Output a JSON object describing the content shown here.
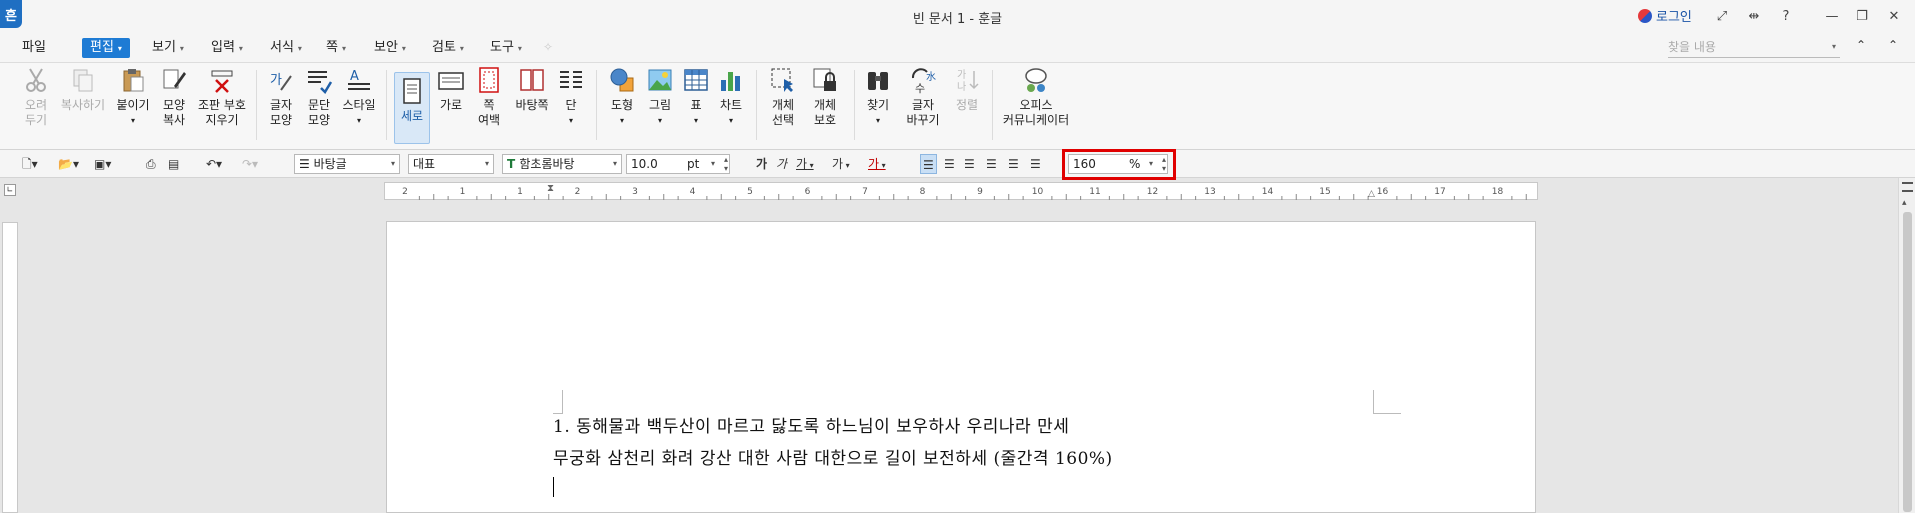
{
  "app": {
    "logo_letter": "흔",
    "title": "빈 문서 1 - 훈글",
    "login_label": "로그인"
  },
  "window_buttons": [
    "⤢",
    "⇹",
    "?",
    "—",
    "❐",
    "✕"
  ],
  "menus": [
    {
      "label": "파일",
      "arrow": ""
    },
    {
      "label": "편집",
      "arrow": "▾"
    },
    {
      "label": "보기",
      "arrow": "▾"
    },
    {
      "label": "입력",
      "arrow": "▾"
    },
    {
      "label": "서식",
      "arrow": "▾"
    },
    {
      "label": "쪽",
      "arrow": "▾"
    },
    {
      "label": "보안",
      "arrow": "▾"
    },
    {
      "label": "검토",
      "arrow": "▾"
    },
    {
      "label": "도구",
      "arrow": "▾"
    }
  ],
  "search": {
    "placeholder": "찾을 내용"
  },
  "ribbon": {
    "cut": [
      "오려",
      "두기"
    ],
    "copy": [
      "복사하기"
    ],
    "paste": [
      "붙이기"
    ],
    "format_copy": [
      "모양",
      "복사"
    ],
    "erase_marks": [
      "조판 부호",
      "지우기"
    ],
    "char_shape": [
      "글자",
      "모양"
    ],
    "para_shape": [
      "문단",
      "모양"
    ],
    "style": [
      "스타일"
    ],
    "portrait": [
      "세로"
    ],
    "landscape": [
      "가로"
    ],
    "page_margin": [
      "쪽",
      "여백"
    ],
    "background": [
      "바탕쪽"
    ],
    "columns": [
      "단"
    ],
    "shape": [
      "도형"
    ],
    "picture": [
      "그림"
    ],
    "table": [
      "표"
    ],
    "chart": [
      "차트"
    ],
    "select_object": [
      "개체",
      "선택"
    ],
    "protect_object": [
      "개체",
      "보호"
    ],
    "find": [
      "찾기"
    ],
    "replace_char": [
      "글자",
      "바꾸기"
    ],
    "align_objects": [
      "정렬"
    ],
    "office_communicator": [
      "오피스",
      "커뮤니케이터"
    ]
  },
  "format": {
    "style": "바탕글",
    "lang": "대표",
    "font": "함초롬바탕",
    "font_size": "10.0",
    "font_unit": "pt",
    "bold": "가",
    "italic": "가",
    "underline": "가",
    "strike": "가",
    "color_char": "가",
    "line_spacing_value": "160",
    "line_spacing_unit": "%"
  },
  "ruler": {
    "ticks": [
      "2",
      "1",
      "1",
      "2",
      "3",
      "4",
      "5",
      "6",
      "7",
      "8",
      "9",
      "10",
      "11",
      "12",
      "13",
      "14",
      "15",
      "16",
      "17",
      "18"
    ]
  },
  "document": {
    "lines": [
      "1. 동해물과 백두산이 마르고 닳도록 하느님이 보우하사 우리나라 만세",
      "무궁화 삼천리 화려 강산 대한 사람 대한으로 길이 보전하세 (줄간격 160%)"
    ]
  }
}
